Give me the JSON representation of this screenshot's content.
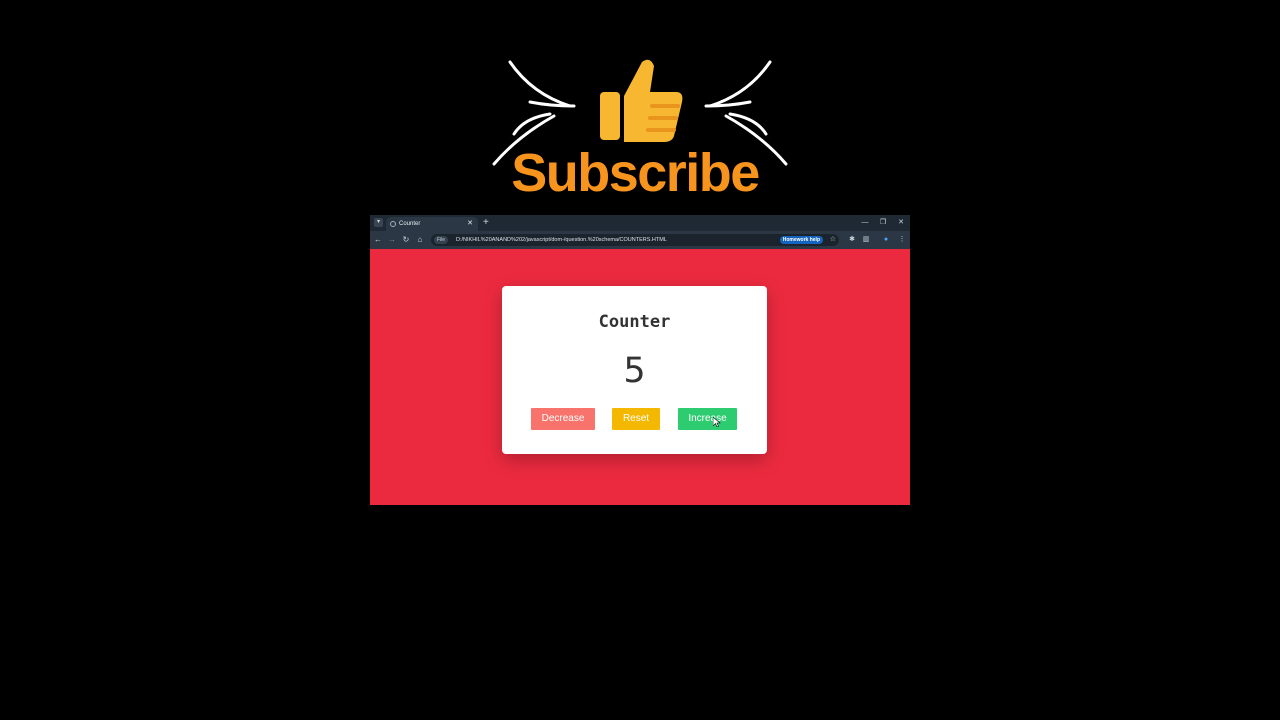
{
  "overlay": {
    "subscribe_label": "Subscribe",
    "thumb_icon": "thumbs-up-icon",
    "colors": {
      "subscribe_text": "#f7941d",
      "thumb": "#f7b731"
    }
  },
  "browser": {
    "tab_title": "Counter",
    "new_tab_label": "+",
    "address": {
      "scheme_label": "File",
      "url": "D:/NIKHIL%20ANAND%202/javascript/dom-/question.%20schema/COUNTERS.HTML"
    },
    "homework_help_label": "Homework help",
    "page_background": "#ec2a3f"
  },
  "counter_app": {
    "title": "Counter",
    "count": "5",
    "buttons": {
      "decrease": "Decrease",
      "reset": "Reset",
      "increase": "Increase"
    },
    "colors": {
      "decrease": "#f7736b",
      "reset": "#f5b800",
      "increase": "#2ecc71"
    }
  }
}
